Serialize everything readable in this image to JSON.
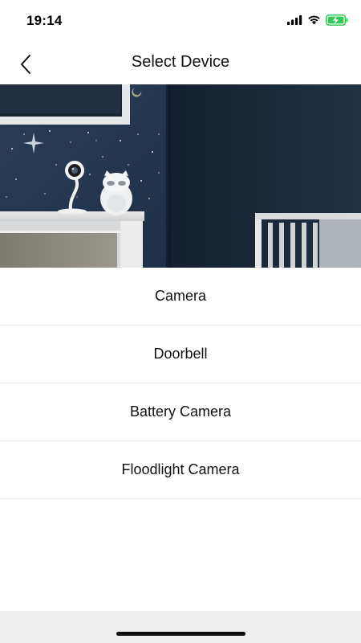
{
  "status_bar": {
    "time": "19:14"
  },
  "nav": {
    "title": "Select Device",
    "back_icon": "chevron-left-icon"
  },
  "hero": {
    "description_icon": "nursery-camera-photo"
  },
  "devices": [
    {
      "label": "Camera"
    },
    {
      "label": "Doorbell"
    },
    {
      "label": "Battery Camera"
    },
    {
      "label": "Floodlight Camera"
    }
  ],
  "colors": {
    "accent_battery": "#34c759",
    "divider": "#ececec",
    "bottom_bar": "#efefef"
  }
}
